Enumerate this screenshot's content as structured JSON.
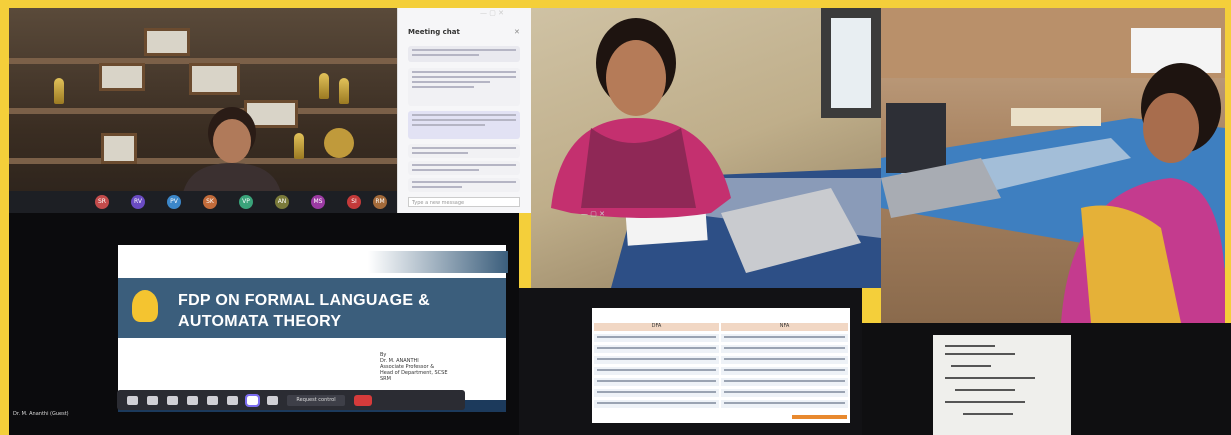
{
  "chat": {
    "title": "Meeting chat",
    "input_placeholder": "Type a new message"
  },
  "participants": [
    "SR",
    "RV",
    "PV",
    "SK",
    "VP",
    "AN",
    "MS",
    "SI",
    "RM"
  ],
  "slide": {
    "title_line1": "FDP ON FORMAL LANGUAGE &",
    "title_line2": "AUTOMATA THEORY",
    "author_by": "By",
    "author_name": "Dr. M. ANANTHI",
    "author_role": "Associate Professor &",
    "author_dept": "Head of Department, SCSE",
    "author_inst": "SRM"
  },
  "presenter_tag": "Dr. M. Ananthi (Guest)",
  "toolbar": {
    "request_control": "Request control"
  },
  "table_slide": {
    "col1": "DFA",
    "col2": "NFA"
  },
  "colors": {
    "border": "#f4cf3a",
    "slide_band": "#3b5e7c",
    "leave": "#d63b3b",
    "active_outline": "#7b6cf0"
  }
}
